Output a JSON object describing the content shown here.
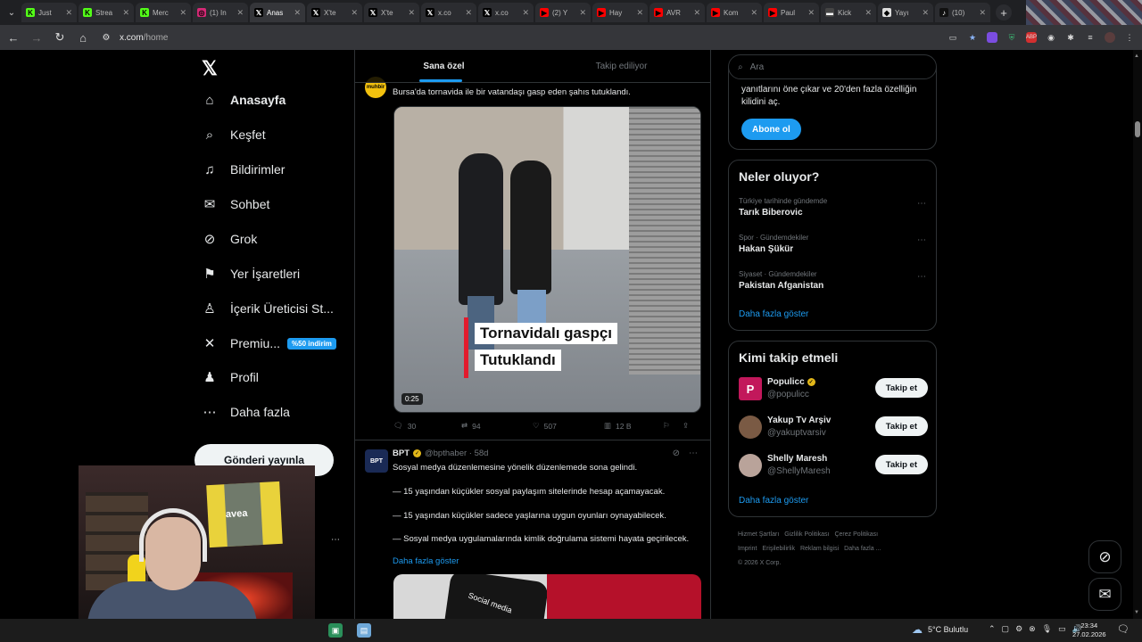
{
  "browser": {
    "tabs": [
      {
        "title": "Just",
        "fav": "K",
        "color": "#53fc18",
        "active": false
      },
      {
        "title": "Strea",
        "fav": "K",
        "color": "#53fc18",
        "active": false
      },
      {
        "title": "Merc",
        "fav": "K",
        "color": "#53fc18",
        "active": false
      },
      {
        "title": "(1) In",
        "fav": "◎",
        "color": "#d62976",
        "active": false
      },
      {
        "title": "Anas",
        "fav": "𝕏",
        "color": "#000000",
        "active": true
      },
      {
        "title": "X'te",
        "fav": "𝕏",
        "color": "#000000",
        "active": false
      },
      {
        "title": "X'te",
        "fav": "𝕏",
        "color": "#000000",
        "active": false
      },
      {
        "title": "x.co",
        "fav": "𝕏",
        "color": "#000000",
        "active": false
      },
      {
        "title": "x.co",
        "fav": "𝕏",
        "color": "#000000",
        "active": false
      },
      {
        "title": "(2) Y",
        "fav": "▶",
        "color": "#ff0000",
        "active": false
      },
      {
        "title": "Hay",
        "fav": "▶",
        "color": "#ff0000",
        "active": false
      },
      {
        "title": "AVR",
        "fav": "▶",
        "color": "#ff0000",
        "active": false
      },
      {
        "title": "Kom",
        "fav": "▶",
        "color": "#ff0000",
        "active": false
      },
      {
        "title": "Paul",
        "fav": "▶",
        "color": "#ff0000",
        "active": false
      },
      {
        "title": "Kick",
        "fav": "▬",
        "color": "#444444",
        "active": false
      },
      {
        "title": "Yayı",
        "fav": "◆",
        "color": "#dddddd",
        "active": false
      },
      {
        "title": "(10)",
        "fav": "♪",
        "color": "#111111",
        "active": false
      }
    ],
    "new_tab": "+",
    "close_glyph": "✕",
    "url_host": "x.com",
    "url_path": "/home"
  },
  "nav": {
    "items": [
      {
        "label": "Anasayfa",
        "icon": "home-icon",
        "glyph": "⌂",
        "active": true
      },
      {
        "label": "Keşfet",
        "icon": "search-icon",
        "glyph": "⌕",
        "active": false
      },
      {
        "label": "Bildirimler",
        "icon": "bell-icon",
        "glyph": "♫",
        "active": false
      },
      {
        "label": "Sohbet",
        "icon": "mail-icon",
        "glyph": "✉",
        "active": false
      },
      {
        "label": "Grok",
        "icon": "grok-icon",
        "glyph": "⊘",
        "active": false
      },
      {
        "label": "Yer İşaretleri",
        "icon": "bookmark-icon",
        "glyph": "⚑",
        "active": false
      },
      {
        "label": "İçerik Üreticisi St...",
        "icon": "creator-icon",
        "glyph": "♙",
        "active": false
      },
      {
        "label": "Premiu...",
        "icon": "x-premium-icon",
        "glyph": "✕",
        "active": false,
        "badge": "%50 indirim"
      },
      {
        "label": "Profil",
        "icon": "person-icon",
        "glyph": "♟",
        "active": false
      },
      {
        "label": "Daha fazla",
        "icon": "more-circle-icon",
        "glyph": "⋯",
        "active": false
      }
    ],
    "post_button": "Gönderi yayınla"
  },
  "main": {
    "tabs": [
      "Sana özel",
      "Takip ediliyor"
    ],
    "tweet1": {
      "avatar_text": "muhbir",
      "text": "Bursa'da tornavida ile bir vatandaşı gasp eden şahıs tutuklandı.",
      "caption_line1": "Tornavidalı gaspçı",
      "caption_line2": "Tutuklandı",
      "duration": "0:25",
      "replies": "30",
      "reposts": "94",
      "likes": "507",
      "views": "12 B"
    },
    "tweet2": {
      "avatar_text": "BPT",
      "name": "BPT",
      "handle": "@bpthaber · 58d",
      "line1": "Sosyal medya düzenlemesine yönelik düzenlemede sona gelindi.",
      "line2": "— 15 yaşından küçükler sosyal paylaşım sitelerinde hesap açamayacak.",
      "line3": "— 15 yaşından küçükler sadece yaşlarına uygun oyunları oynayabilecek.",
      "line4": "— Sosyal medya uygulamalarında kimlik doğrulama sistemi hayata geçirilecek.",
      "show_more": "Daha fazla göster",
      "media_text": "Social media"
    }
  },
  "right": {
    "search_placeholder": "Ara",
    "premium_text": "yanıtlarını öne çıkar ve 20'den fazla özelliğin kilidini aç.",
    "subscribe": "Abone ol",
    "trends_title": "Neler oluyor?",
    "trends": [
      {
        "context": "Türkiye tarihinde gündemde",
        "name": "Tarık Biberovic"
      },
      {
        "context": "Spor · Gündemdekiler",
        "name": "Hakan Şükür"
      },
      {
        "context": "Siyaset · Gündemdekiler",
        "name": "Pakistan Afganistan"
      }
    ],
    "trends_more": "Daha fazla göster",
    "who_title": "Kimi takip etmeli",
    "who": [
      {
        "name": "Populicc",
        "handle": "@populicc",
        "verified": true,
        "avatar_color": "#c2185b",
        "avatar_text": "P"
      },
      {
        "name": "Yakup Tv Arşiv",
        "handle": "@yakuptvarsiv",
        "verified": false,
        "avatar_color": "#7a5a44",
        "avatar_text": ""
      },
      {
        "name": "Shelly Maresh",
        "handle": "@ShellyMaresh",
        "verified": false,
        "avatar_color": "#b9a39a",
        "avatar_text": ""
      }
    ],
    "follow_label": "Takip et",
    "who_more": "Daha fazla göster",
    "footer": [
      "Hizmet Şartları",
      "Gizlilik Politikası",
      "Çerez Politikası",
      "Imprint",
      "Erişilebilirlik",
      "Reklam bilgisi",
      "Daha fazla ...",
      "© 2026 X Corp."
    ]
  },
  "webcam": {
    "jersey_brand": "avea"
  },
  "taskbar": {
    "weather": "5°C  Bulutlu",
    "time": "23:34",
    "date": "27.02.2026"
  }
}
